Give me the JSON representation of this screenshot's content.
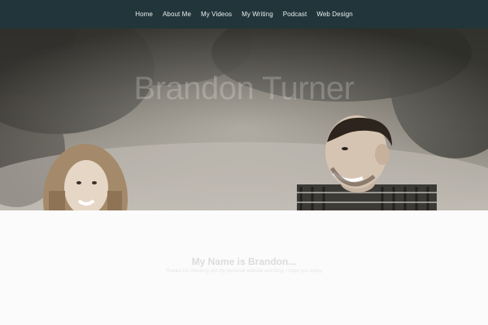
{
  "nav": {
    "items": [
      {
        "label": "Home"
      },
      {
        "label": "About Me"
      },
      {
        "label": "My Videos"
      },
      {
        "label": "My Writing"
      },
      {
        "label": "Podcast"
      },
      {
        "label": "Web Design"
      }
    ]
  },
  "hero": {
    "title": "Brandon Turner"
  },
  "intro": {
    "heading": "My Name is Brandon...",
    "subtitle": "Thanks for checking out my personal website and blog. I hope you enjoy."
  },
  "colors": {
    "nav_background": "#22353a",
    "nav_text": "#e8eeee",
    "page_background": "#fbfbfb"
  }
}
